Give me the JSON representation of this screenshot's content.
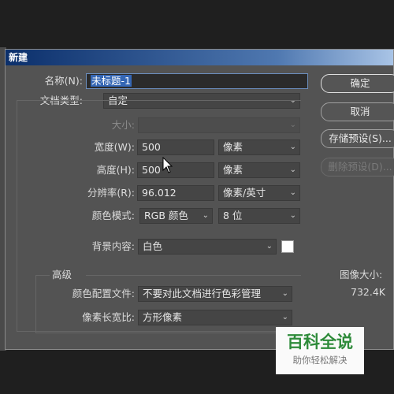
{
  "dialog": {
    "title": "新建"
  },
  "form": {
    "name_label": "名称(N):",
    "name_value": "未标题-1",
    "doc_type_label": "文档类型:",
    "doc_type_value": "自定",
    "size_label": "大小:",
    "size_value": "",
    "width_label": "宽度(W):",
    "width_value": "500",
    "width_unit": "像素",
    "height_label": "高度(H):",
    "height_value": "500",
    "height_unit": "像素",
    "resolution_label": "分辨率(R):",
    "resolution_value": "96.012",
    "resolution_unit": "像素/英寸",
    "color_mode_label": "颜色模式:",
    "color_mode_value": "RGB 颜色",
    "bit_depth_value": "8 位",
    "background_label": "背景内容:",
    "background_value": "白色",
    "background_swatch_color": "#ffffff"
  },
  "advanced": {
    "title": "高级",
    "profile_label": "颜色配置文件:",
    "profile_value": "不要对此文档进行色彩管理",
    "aspect_label": "像素长宽比:",
    "aspect_value": "方形像素"
  },
  "buttons": {
    "ok": "确定",
    "cancel": "取消",
    "save_preset": "存储预设(S)...",
    "delete_preset": "删除预设(D)..."
  },
  "image_size": {
    "label": "图像大小:",
    "value": "732.4K"
  },
  "watermark": {
    "title": "百科全说",
    "subtitle": "助你轻松解决"
  }
}
